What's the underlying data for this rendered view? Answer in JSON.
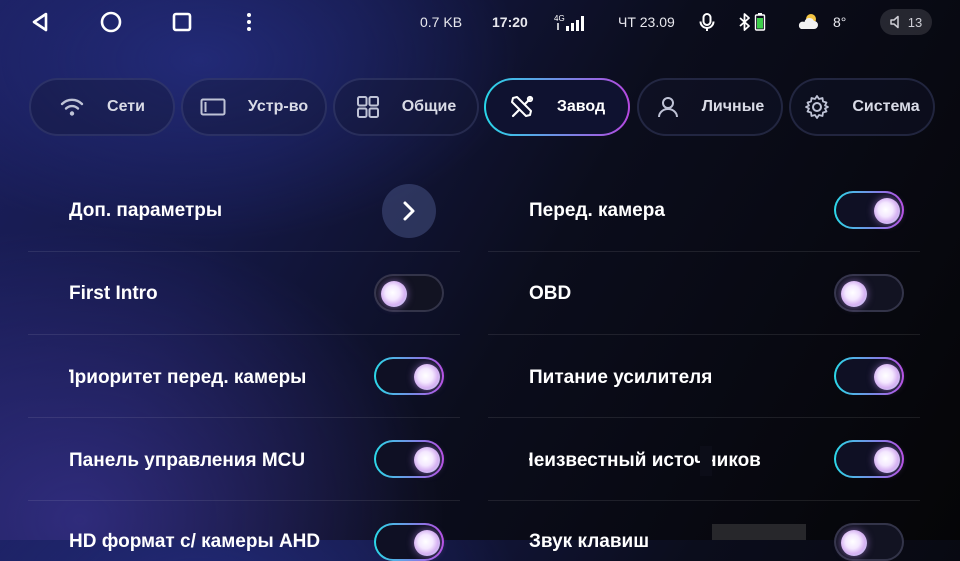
{
  "status_bar": {
    "net_speed": "0.7 KB",
    "time": "17:20",
    "network_type": "4G",
    "date": "ЧТ 23.09",
    "temperature": "8°",
    "volume": "13",
    "icons": [
      "back-icon",
      "home-icon",
      "recents-icon",
      "more-vert-icon",
      "signal-icon",
      "mic-icon",
      "bluetooth-icon",
      "battery-icon",
      "weather-icon",
      "volume-icon"
    ]
  },
  "tabs": [
    {
      "label": "Сети",
      "icon": "wifi-icon",
      "active": false
    },
    {
      "label": "Устр-во",
      "icon": "display-icon",
      "active": false
    },
    {
      "label": "Общие",
      "icon": "grid-icon",
      "active": false
    },
    {
      "label": "Завод",
      "icon": "tools-icon",
      "active": true
    },
    {
      "label": "Личные",
      "icon": "user-icon",
      "active": false
    },
    {
      "label": "Система",
      "icon": "gear-icon",
      "active": false
    }
  ],
  "settings_left": [
    {
      "label": "Доп. параметры",
      "control": "arrow"
    },
    {
      "label": "First Intro",
      "control": "toggle",
      "on": false
    },
    {
      "label": "Приоритет перед. камеры",
      "control": "toggle",
      "on": true
    },
    {
      "label": "Панель управления MCU",
      "control": "toggle",
      "on": true
    },
    {
      "label": "HD формат с/ камеры AHD",
      "control": "toggle",
      "on": true
    }
  ],
  "settings_right": [
    {
      "label": "Перед. камера",
      "control": "toggle",
      "on": true
    },
    {
      "label": "OBD",
      "control": "toggle",
      "on": false
    },
    {
      "label": "Питание усилителя",
      "control": "toggle",
      "on": true
    },
    {
      "label": "Неизвестный источников",
      "control": "toggle",
      "on": true
    },
    {
      "label": "Звук клавиш",
      "control": "toggle",
      "on": false
    }
  ],
  "colors": {
    "accent_cyan": "#27d6e8",
    "accent_purple": "#b548e0"
  }
}
